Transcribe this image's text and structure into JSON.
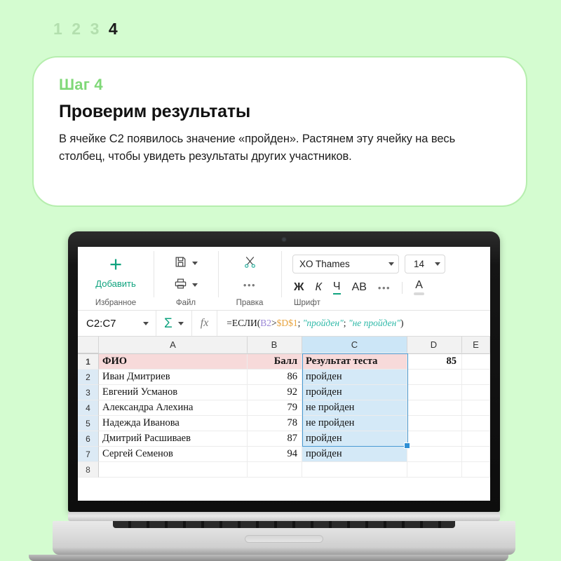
{
  "pager": {
    "steps": [
      "1",
      "2",
      "3",
      "4"
    ],
    "active_index": 3
  },
  "card": {
    "step_label": "Шаг 4",
    "title": "Проверим результаты",
    "body": "В ячейке C2 появилось значение «пройден». Растянем эту ячейку на весь столбец, чтобы увидеть результаты других участников."
  },
  "app": {
    "toolbar": {
      "groups": [
        {
          "label": "Избранное",
          "add_label": "Добавить",
          "add_icon": "plus-icon"
        },
        {
          "label": "Файл",
          "save_icon": "floppy-save-icon",
          "print_icon": "printer-icon"
        },
        {
          "label": "Правка",
          "cut_icon": "scissors-icon",
          "more_icon": "ellipsis-icon"
        },
        {
          "label": "Шрифт",
          "font_name": "XO Thames",
          "font_size": "14",
          "bold_label": "Ж",
          "italic_label": "К",
          "underline_label": "Ч",
          "strike_label": "АВ",
          "more_icon": "ellipsis-icon",
          "font_color_label": "A"
        }
      ]
    },
    "formula_bar": {
      "name_box": "C2:C7",
      "sum_icon": "sigma-icon",
      "fx_icon": "fx-icon",
      "formula_prefix": "=ЕСЛИ(",
      "formula_ref1": "B2",
      "formula_op": ">",
      "formula_ref2": "$D$1",
      "formula_sep1": "; ",
      "formula_str1": "\"пройден\"",
      "formula_sep2": "; ",
      "formula_str2": "\"не пройден\"",
      "formula_suffix": ")"
    },
    "grid": {
      "columns": [
        "A",
        "B",
        "C",
        "D",
        "E"
      ],
      "selected_column": "C",
      "rows": [
        {
          "num": "1",
          "a": "ФИО",
          "b": "Балл",
          "c": "Результат теста",
          "d": "85",
          "e": ""
        },
        {
          "num": "2",
          "a": "Иван Дмитриев",
          "b": "86",
          "c": "пройден",
          "d": "",
          "e": ""
        },
        {
          "num": "3",
          "a": "Евгений Усманов",
          "b": "92",
          "c": "пройден",
          "d": "",
          "e": ""
        },
        {
          "num": "4",
          "a": "Александра Алехина",
          "b": "79",
          "c": "не пройден",
          "d": "",
          "e": ""
        },
        {
          "num": "5",
          "a": "Надежда Иванова",
          "b": "78",
          "c": "не пройден",
          "d": "",
          "e": ""
        },
        {
          "num": "6",
          "a": "Дмитрий Расшиваев",
          "b": "87",
          "c": "пройден",
          "d": "",
          "e": ""
        },
        {
          "num": "7",
          "a": "Сергей Семенов",
          "b": "94",
          "c": "пройден",
          "d": "",
          "e": ""
        },
        {
          "num": "8",
          "a": "",
          "b": "",
          "c": "",
          "d": "",
          "e": ""
        }
      ]
    }
  },
  "colors": {
    "background": "#d4fcd0",
    "accent_green": "#7fd877",
    "card_border": "#b6eeae",
    "app_accent": "#10a37f",
    "header_row": "#f7dada",
    "selection_fill": "#d4e9f7",
    "selection_border": "#4a9bd4"
  }
}
